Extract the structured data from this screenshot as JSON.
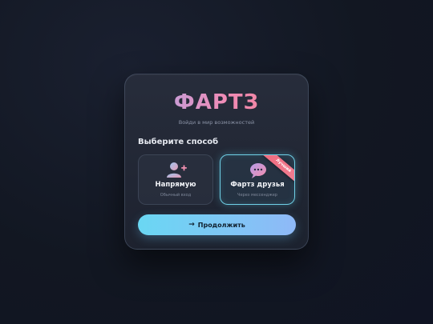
{
  "brand": {
    "logo": "ФАРТЗ",
    "tagline": "Войди в мир возможностей"
  },
  "heading": "Выберите способ",
  "options": [
    {
      "title": "Напрямую",
      "subtitle": "Обычный вход",
      "icon": "user-plus-icon",
      "selected": false
    },
    {
      "title": "Фартз друзья",
      "subtitle": "Через мессенджер",
      "icon": "chat-bubble-icon",
      "selected": true,
      "badge": "Лучший"
    }
  ],
  "continue_button": {
    "label": "Продолжить",
    "icon": "arrow-right-icon"
  },
  "colors": {
    "accent_cyan": "#6ad7f3",
    "accent_pink": "#f08cb6",
    "ribbon": "#f06a7d"
  }
}
